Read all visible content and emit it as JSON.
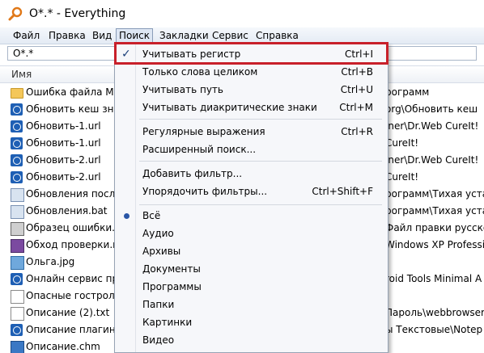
{
  "window": {
    "title": "O*.* - Everything",
    "app_icon": "magnifier-icon"
  },
  "menubar": {
    "items": [
      "Файл",
      "Правка",
      "Вид",
      "Поиск",
      "Закладки",
      "Сервис",
      "Справка"
    ]
  },
  "search": {
    "value": "O*.*"
  },
  "columns": {
    "name": "Имя"
  },
  "files": [
    {
      "name": "Ошибка файла MS",
      "path": "рограмм",
      "icon": "folder-icon"
    },
    {
      "name": "Обновить кеш зна",
      "path": "org\\Обновить кеш",
      "icon": "url-icon"
    },
    {
      "name": "Обновить-1.url",
      "path": "iner\\Dr.Web CureIt!",
      "icon": "url-icon"
    },
    {
      "name": "Обновить-1.url",
      "path": "CureIt!",
      "icon": "url-icon"
    },
    {
      "name": "Обновить-2.url",
      "path": "iner\\Dr.Web CureIt!",
      "icon": "url-icon"
    },
    {
      "name": "Обновить-2.url",
      "path": "CureIt!",
      "icon": "url-icon"
    },
    {
      "name": "Обновления посл",
      "path": "рограмм\\Тихая уста",
      "icon": "generic-icon"
    },
    {
      "name": "Обновления.bat",
      "path": "рограмм\\Тихая уста",
      "icon": "bat-icon"
    },
    {
      "name": "Образец ошибки.",
      "path": "Файл правки русско",
      "icon": "bmp-icon"
    },
    {
      "name": "Обход проверки.r",
      "path": "Windows XP Professi",
      "icon": "rar-icon"
    },
    {
      "name": "Ольга.jpg",
      "path": "",
      "icon": "jpg-icon"
    },
    {
      "name": "Онлайн сервис пр",
      "path": "roid Tools Minimal A",
      "icon": "url-icon"
    },
    {
      "name": "Опасные гострол",
      "path": "",
      "icon": "txt-icon"
    },
    {
      "name": "Описание (2).txt",
      "path": "Пароль\\webbrowser",
      "icon": "txt-icon"
    },
    {
      "name": "Описание плагино",
      "path": "ы Текстовые\\Notep",
      "icon": "url-icon"
    },
    {
      "name": "Описание.chm",
      "path": "",
      "icon": "chm-icon"
    }
  ],
  "search_menu": {
    "items": [
      {
        "label": "Учитывать регистр",
        "shortcut": "Ctrl+I",
        "checked": true
      },
      {
        "label": "Только слова целиком",
        "shortcut": "Ctrl+B"
      },
      {
        "label": "Учитывать путь",
        "shortcut": "Ctrl+U"
      },
      {
        "label": "Учитывать диакритические знаки",
        "shortcut": "Ctrl+M"
      },
      {
        "label": "Регулярные выражения",
        "shortcut": "Ctrl+R"
      },
      {
        "label": "Расширенный поиск...",
        "shortcut": ""
      },
      {
        "label": "Добавить фильтр...",
        "shortcut": ""
      },
      {
        "label": "Упорядочить фильтры...",
        "shortcut": "Ctrl+Shift+F"
      },
      {
        "label": "Всё",
        "shortcut": "",
        "selected": true
      },
      {
        "label": "Аудио",
        "shortcut": ""
      },
      {
        "label": "Архивы",
        "shortcut": ""
      },
      {
        "label": "Документы",
        "shortcut": ""
      },
      {
        "label": "Программы",
        "shortcut": ""
      },
      {
        "label": "Папки",
        "shortcut": ""
      },
      {
        "label": "Картинки",
        "shortcut": ""
      },
      {
        "label": "Видео",
        "shortcut": ""
      }
    ],
    "check_glyph": "✓"
  },
  "colors": {
    "highlight": "#c8202a",
    "menu_bg": "#f6f7fa"
  }
}
